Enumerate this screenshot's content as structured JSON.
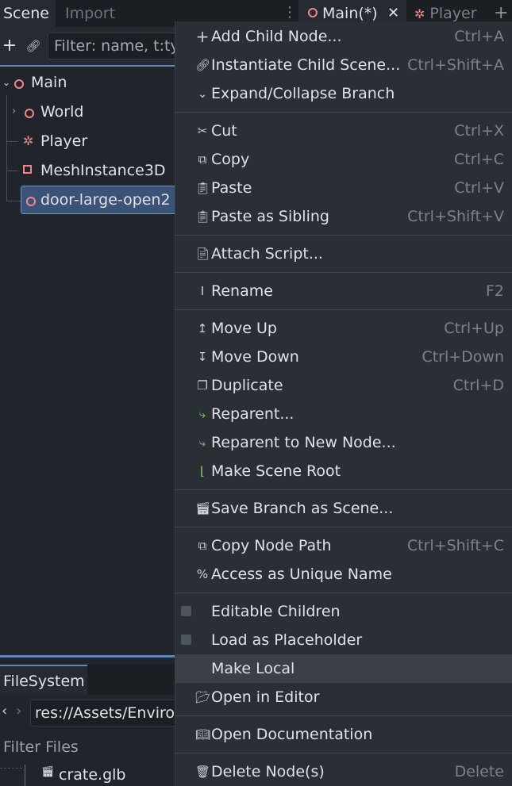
{
  "dock_tabs": {
    "scene": "Scene",
    "import": "Import"
  },
  "editor_tabs": {
    "main": "Main(*)",
    "player": "Player"
  },
  "scene_panel": {
    "filter_placeholder": "Filter: name, t:ty"
  },
  "tree": [
    {
      "label": "Main",
      "icon": "node3d-icon"
    },
    {
      "label": "World",
      "icon": "node3d-icon"
    },
    {
      "label": "Player",
      "icon": "character-icon"
    },
    {
      "label": "MeshInstance3D",
      "icon": "mesh-instance-icon"
    },
    {
      "label": "door-large-open2",
      "icon": "node3d-icon"
    }
  ],
  "filesystem": {
    "tab": "FileSystem",
    "path": "res://Assets/Enviro",
    "filter": "Filter Files",
    "file": "crate.glb"
  },
  "menu": {
    "add_child": {
      "label": "Add Child Node...",
      "shortcut": "Ctrl+A"
    },
    "instantiate": {
      "label": "Instantiate Child Scene...",
      "shortcut": "Ctrl+Shift+A"
    },
    "expand": {
      "label": "Expand/Collapse Branch"
    },
    "cut": {
      "label": "Cut",
      "shortcut": "Ctrl+X"
    },
    "copy": {
      "label": "Copy",
      "shortcut": "Ctrl+C"
    },
    "paste": {
      "label": "Paste",
      "shortcut": "Ctrl+V"
    },
    "paste_sibling": {
      "label": "Paste as Sibling",
      "shortcut": "Ctrl+Shift+V"
    },
    "attach_script": {
      "label": "Attach Script..."
    },
    "rename": {
      "label": "Rename",
      "shortcut": "F2"
    },
    "move_up": {
      "label": "Move Up",
      "shortcut": "Ctrl+Up"
    },
    "move_down": {
      "label": "Move Down",
      "shortcut": "Ctrl+Down"
    },
    "duplicate": {
      "label": "Duplicate",
      "shortcut": "Ctrl+D"
    },
    "reparent": {
      "label": "Reparent..."
    },
    "reparent_new": {
      "label": "Reparent to New Node..."
    },
    "make_root": {
      "label": "Make Scene Root"
    },
    "save_branch": {
      "label": "Save Branch as Scene..."
    },
    "copy_path": {
      "label": "Copy Node Path",
      "shortcut": "Ctrl+Shift+C"
    },
    "unique_name": {
      "label": "Access as Unique Name"
    },
    "editable_children": {
      "label": "Editable Children",
      "checked": false
    },
    "load_placeholder": {
      "label": "Load as Placeholder",
      "checked": false
    },
    "make_local": {
      "label": "Make Local"
    },
    "open_editor": {
      "label": "Open in Editor"
    },
    "open_docs": {
      "label": "Open Documentation"
    },
    "delete": {
      "label": "Delete Node(s)",
      "shortcut": "Delete"
    }
  },
  "colors": {
    "accent": "#5f87b8",
    "node_icon": "#f0868c",
    "selection": "#3a5376",
    "menu_bg": "#2a2e35"
  }
}
